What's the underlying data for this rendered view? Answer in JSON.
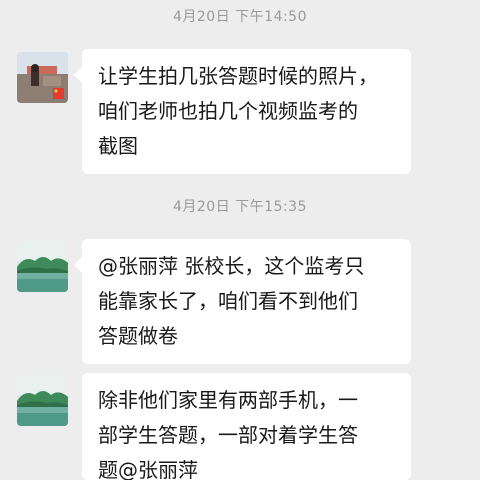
{
  "messages": [
    {
      "timestamp": "4月20日 下午14:50",
      "avatar_icon": "photo-avatar-icon",
      "lines": [
        "让学生拍几张答题时候的照片，",
        "咱们老师也拍几个视频监考的",
        "截图"
      ]
    },
    {
      "timestamp": "4月20日 下午15:35",
      "avatar_icon": "landscape-avatar-icon",
      "lines": [
        "@张丽萍  张校长，这个监考只",
        "能靠家长了，咱们看不到他们",
        "答题做卷"
      ]
    },
    {
      "avatar_icon": "landscape-avatar-icon",
      "lines": [
        "除非他们家里有两部手机，一",
        "部学生答题，一部对着学生答",
        "题@张丽萍"
      ]
    }
  ]
}
